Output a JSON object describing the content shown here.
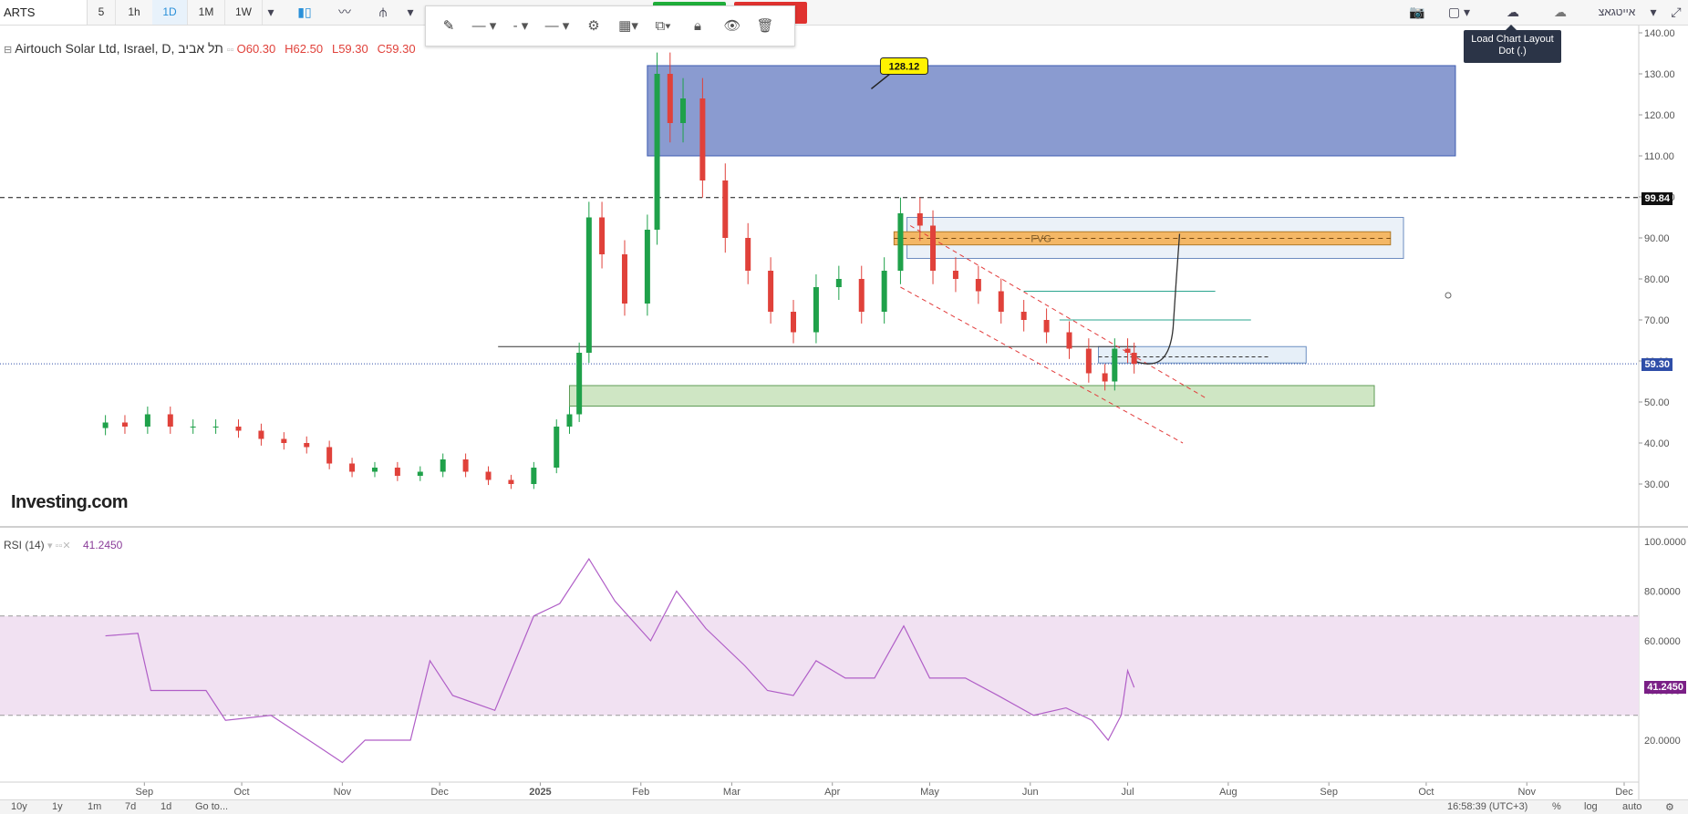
{
  "toolbar": {
    "symbol": "ARTS",
    "timeframes": [
      "5",
      "1h",
      "1D",
      "1M",
      "1W"
    ],
    "active_timeframe": "1D",
    "tooltip_line1": "Load Chart Layout",
    "tooltip_line2": "Dot (.)",
    "user_label": "אייטגאצ",
    "icons": [
      "candles-icon",
      "line-icon",
      "indicator-icon",
      "camera-icon",
      "cloud-load-icon",
      "cloud-save-icon",
      "fullscreen-icon"
    ]
  },
  "drawbar": {
    "icons": [
      "pencil-icon",
      "line-style-icon",
      "dash-style-icon",
      "width-icon",
      "gear-icon",
      "layers-icon",
      "copy-icon",
      "lock-icon",
      "eye-icon",
      "trash-icon"
    ]
  },
  "legend": {
    "title": "Airtouch Solar Ltd, Israel, D, תל אביב",
    "o": "O60.30",
    "h": "H62.50",
    "l": "L59.30",
    "c": "C59.30",
    "logo": "Investing.com"
  },
  "rsi_legend": {
    "label": "RSI (14)",
    "value": "41.2450"
  },
  "annotations": {
    "callout": "128.12",
    "fvg": "FVG",
    "dashed_level": "99.84",
    "last_price": "59.30",
    "rsi_last": "41.2450"
  },
  "colors": {
    "up": "#1fa14a",
    "down": "#e0413a",
    "supply_zone": "#8a9bd0",
    "demand_zone": "#cfe6c4",
    "fvg_zone": "#f4b765",
    "rsi_line": "#b05ec7",
    "rsi_band": "#f1e1f2",
    "last_price_label": "#2f4ea8",
    "rsi_label": "#7a1f86"
  },
  "bottombar": {
    "ranges": [
      "10y",
      "1y",
      "1m",
      "7d",
      "1d",
      "Go to..."
    ],
    "time": "16:58:39 (UTC+3)",
    "options": [
      "%",
      "log",
      "auto"
    ]
  },
  "chart_data": {
    "type": "candlestick",
    "title": "Airtouch Solar Ltd, Israel, D, תל אביב",
    "x_tick_labels": [
      "Sep",
      "Oct",
      "Nov",
      "Dec",
      "2025",
      "Feb",
      "Mar",
      "Apr",
      "May",
      "Jun",
      "Jul",
      "Aug",
      "Sep",
      "Oct",
      "Nov",
      "Dec"
    ],
    "y_tick_labels": [
      "30.00",
      "40.00",
      "50.00",
      "60.00",
      "70.00",
      "80.00",
      "90.00",
      "100.00",
      "110.00",
      "120.00",
      "130.00",
      "140.00"
    ],
    "ylim": [
      24,
      141
    ],
    "close_series": [
      {
        "date": "2024-08-20",
        "close": 45
      },
      {
        "date": "2024-08-26",
        "close": 44
      },
      {
        "date": "2024-09-02",
        "close": 47
      },
      {
        "date": "2024-09-09",
        "close": 44
      },
      {
        "date": "2024-09-16",
        "close": 44
      },
      {
        "date": "2024-09-23",
        "close": 44
      },
      {
        "date": "2024-09-30",
        "close": 43
      },
      {
        "date": "2024-10-07",
        "close": 41
      },
      {
        "date": "2024-10-14",
        "close": 40
      },
      {
        "date": "2024-10-21",
        "close": 39
      },
      {
        "date": "2024-10-28",
        "close": 35
      },
      {
        "date": "2024-11-04",
        "close": 33
      },
      {
        "date": "2024-11-11",
        "close": 34
      },
      {
        "date": "2024-11-18",
        "close": 32
      },
      {
        "date": "2024-11-25",
        "close": 33
      },
      {
        "date": "2024-12-02",
        "close": 36
      },
      {
        "date": "2024-12-09",
        "close": 33
      },
      {
        "date": "2024-12-16",
        "close": 31
      },
      {
        "date": "2024-12-23",
        "close": 30
      },
      {
        "date": "2024-12-30",
        "close": 34
      },
      {
        "date": "2025-01-06",
        "close": 44
      },
      {
        "date": "2025-01-10",
        "close": 47
      },
      {
        "date": "2025-01-13",
        "close": 62
      },
      {
        "date": "2025-01-16",
        "close": 95
      },
      {
        "date": "2025-01-20",
        "close": 86
      },
      {
        "date": "2025-01-27",
        "close": 74
      },
      {
        "date": "2025-02-03",
        "close": 92
      },
      {
        "date": "2025-02-06",
        "close": 130
      },
      {
        "date": "2025-02-10",
        "close": 118
      },
      {
        "date": "2025-02-14",
        "close": 124
      },
      {
        "date": "2025-02-20",
        "close": 104
      },
      {
        "date": "2025-02-27",
        "close": 90
      },
      {
        "date": "2025-03-06",
        "close": 82
      },
      {
        "date": "2025-03-13",
        "close": 72
      },
      {
        "date": "2025-03-20",
        "close": 67
      },
      {
        "date": "2025-03-27",
        "close": 78
      },
      {
        "date": "2025-04-03",
        "close": 80
      },
      {
        "date": "2025-04-10",
        "close": 72
      },
      {
        "date": "2025-04-17",
        "close": 82
      },
      {
        "date": "2025-04-22",
        "close": 96
      },
      {
        "date": "2025-04-28",
        "close": 93
      },
      {
        "date": "2025-05-02",
        "close": 82
      },
      {
        "date": "2025-05-09",
        "close": 80
      },
      {
        "date": "2025-05-16",
        "close": 77
      },
      {
        "date": "2025-05-23",
        "close": 72
      },
      {
        "date": "2025-05-30",
        "close": 70
      },
      {
        "date": "2025-06-06",
        "close": 67
      },
      {
        "date": "2025-06-13",
        "close": 63
      },
      {
        "date": "2025-06-19",
        "close": 57
      },
      {
        "date": "2025-06-24",
        "close": 55
      },
      {
        "date": "2025-06-27",
        "close": 63
      },
      {
        "date": "2025-07-01",
        "close": 62
      },
      {
        "date": "2025-07-03",
        "close": 59.3
      }
    ],
    "zones": [
      {
        "name": "supply",
        "from": "2025-02-03",
        "to": "2025-10-10",
        "low": 110,
        "high": 132
      },
      {
        "name": "FVG",
        "from": "2025-04-20",
        "to": "2025-09-20",
        "low": 88.3,
        "high": 91.5
      },
      {
        "name": "fvg-frame",
        "from": "2025-04-24",
        "to": "2025-09-24",
        "low": 85,
        "high": 95
      },
      {
        "name": "demand",
        "from": "2025-01-10",
        "to": "2025-09-15",
        "low": 49,
        "high": 54
      },
      {
        "name": "reaction-box",
        "from": "2025-06-22",
        "to": "2025-08-25",
        "low": 59.5,
        "high": 63.5
      }
    ],
    "levels": [
      {
        "name": "dashed-resistance",
        "value": 99.84
      },
      {
        "name": "support-line",
        "value": 63.5,
        "from": "2024-12-19",
        "to": "2025-06-28"
      },
      {
        "name": "last-price",
        "value": 59.3
      }
    ],
    "rsi": {
      "name": "RSI (14)",
      "last": 41.245,
      "upper_band": 70,
      "lower_band": 30,
      "y_tick_labels": [
        "20.0000",
        "40.0000",
        "60.0000",
        "80.0000",
        "100.0000"
      ],
      "series": [
        {
          "date": "2024-08-20",
          "value": 62
        },
        {
          "date": "2024-08-30",
          "value": 63
        },
        {
          "date": "2024-09-03",
          "value": 40
        },
        {
          "date": "2024-09-20",
          "value": 40
        },
        {
          "date": "2024-09-26",
          "value": 28
        },
        {
          "date": "2024-10-10",
          "value": 30
        },
        {
          "date": "2024-10-24",
          "value": 18
        },
        {
          "date": "2024-11-01",
          "value": 11
        },
        {
          "date": "2024-11-08",
          "value": 20
        },
        {
          "date": "2024-11-22",
          "value": 20
        },
        {
          "date": "2024-11-28",
          "value": 52
        },
        {
          "date": "2024-12-05",
          "value": 38
        },
        {
          "date": "2024-12-18",
          "value": 32
        },
        {
          "date": "2024-12-30",
          "value": 70
        },
        {
          "date": "2025-01-07",
          "value": 75
        },
        {
          "date": "2025-01-16",
          "value": 93
        },
        {
          "date": "2025-01-24",
          "value": 76
        },
        {
          "date": "2025-02-04",
          "value": 60
        },
        {
          "date": "2025-02-12",
          "value": 80
        },
        {
          "date": "2025-02-21",
          "value": 65
        },
        {
          "date": "2025-03-05",
          "value": 50
        },
        {
          "date": "2025-03-12",
          "value": 40
        },
        {
          "date": "2025-03-20",
          "value": 38
        },
        {
          "date": "2025-03-27",
          "value": 52
        },
        {
          "date": "2025-04-05",
          "value": 45
        },
        {
          "date": "2025-04-14",
          "value": 45
        },
        {
          "date": "2025-04-23",
          "value": 66
        },
        {
          "date": "2025-05-01",
          "value": 45
        },
        {
          "date": "2025-05-12",
          "value": 45
        },
        {
          "date": "2025-05-22",
          "value": 38
        },
        {
          "date": "2025-06-02",
          "value": 30
        },
        {
          "date": "2025-06-12",
          "value": 33
        },
        {
          "date": "2025-06-20",
          "value": 28
        },
        {
          "date": "2025-06-25",
          "value": 20
        },
        {
          "date": "2025-06-29",
          "value": 30
        },
        {
          "date": "2025-07-01",
          "value": 48
        },
        {
          "date": "2025-07-03",
          "value": 41.245
        }
      ]
    }
  }
}
